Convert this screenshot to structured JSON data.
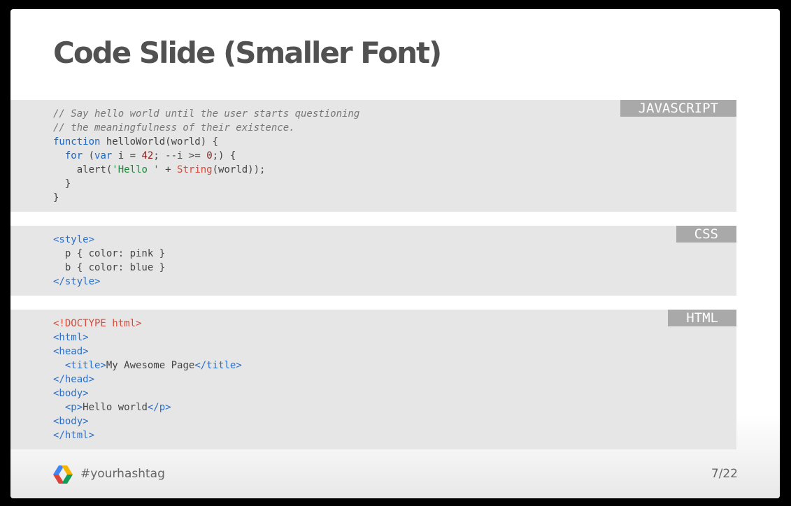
{
  "slide": {
    "title": "Code Slide (Smaller Font)",
    "hashtag": "#yourhashtag",
    "page_number": "7/22"
  },
  "code_blocks": [
    {
      "language": "JAVASCRIPT",
      "lines": [
        "// Say hello world until the user starts questioning",
        "// the meaningfulness of their existence.",
        "function helloWorld(world) {",
        "  for (var i = 42; --i >= 0;) {",
        "    alert('Hello ' + String(world));",
        "  }",
        "}"
      ]
    },
    {
      "language": "CSS",
      "lines": [
        "<style>",
        "  p { color: pink }",
        "  b { color: blue }",
        "</style>"
      ]
    },
    {
      "language": "HTML",
      "lines": [
        "<!DOCTYPE html>",
        "<html>",
        "<head>",
        "  <title>My Awesome Page</title>",
        "</head>",
        "<body>",
        "  <p>Hello world</p>",
        "<body>",
        "</html>"
      ]
    }
  ],
  "icons": {
    "footer_logo": "google-chevron-logo-icon"
  },
  "colors": {
    "code_background": "#e6e6e6",
    "lang_tag_background": "#a9a9a9",
    "keyword": "#1a68c7",
    "string": "#1a8a3a",
    "number": "#8b1a1a",
    "builtin": "#d7493b"
  }
}
